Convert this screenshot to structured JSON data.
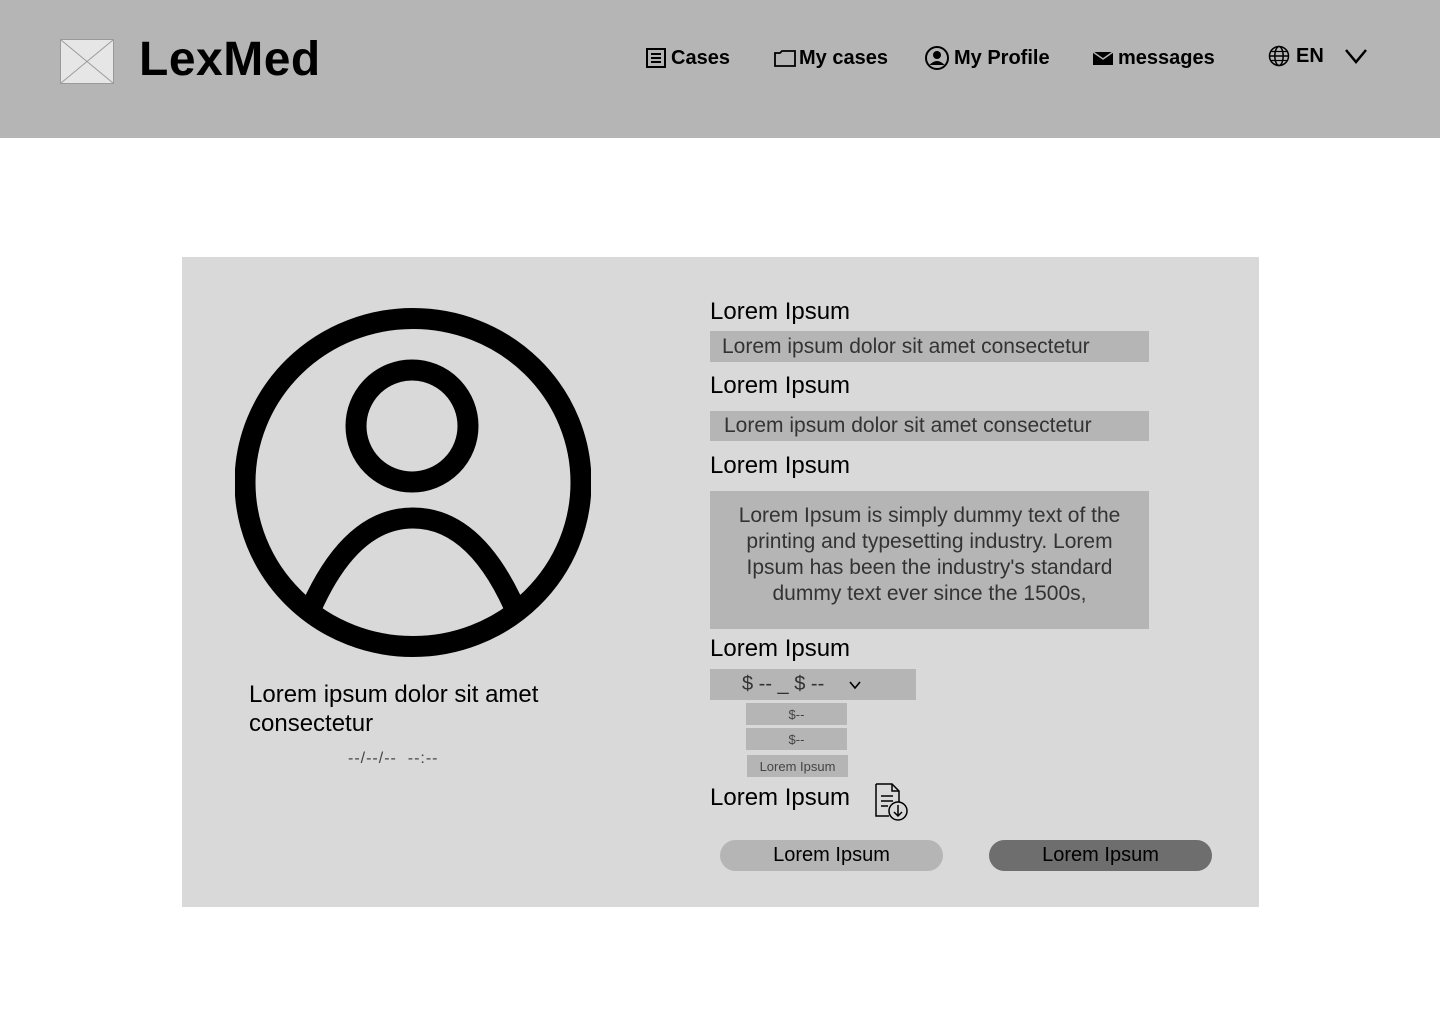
{
  "header": {
    "brand": "LexMed",
    "nav": {
      "cases": "Cases",
      "my_cases": "My cases",
      "my_profile": "My Profile",
      "messages": "messages",
      "language": "EN"
    }
  },
  "profile": {
    "name": "Lorem ipsum dolor sit amet consectetur",
    "datetime": "--/--/--  --:--"
  },
  "fields": [
    {
      "label": "Lorem Ipsum",
      "value": "Lorem ipsum dolor sit amet consectetur"
    },
    {
      "label": "Lorem Ipsum",
      "value": "Lorem ipsum dolor sit amet consectetur"
    },
    {
      "label": "Lorem Ipsum",
      "value": "Lorem Ipsum is simply dummy text of the printing and typesetting industry. Lorem Ipsum has been the industry's standard dummy text ever since the 1500s,"
    },
    {
      "label": "Lorem Ipsum",
      "value": "$ -- _ $ --"
    }
  ],
  "dropdown_options": [
    "$--",
    "$--",
    "Lorem Ipsum"
  ],
  "attachment_label": "Lorem Ipsum",
  "buttons": {
    "secondary": "Lorem Ipsum",
    "primary": "Lorem Ipsum"
  },
  "colors": {
    "header_bg": "#b5b5b5",
    "card_bg": "#d9d9d9",
    "field_bg": "#b5b5b5",
    "primary_button": "#6e6e6e"
  }
}
